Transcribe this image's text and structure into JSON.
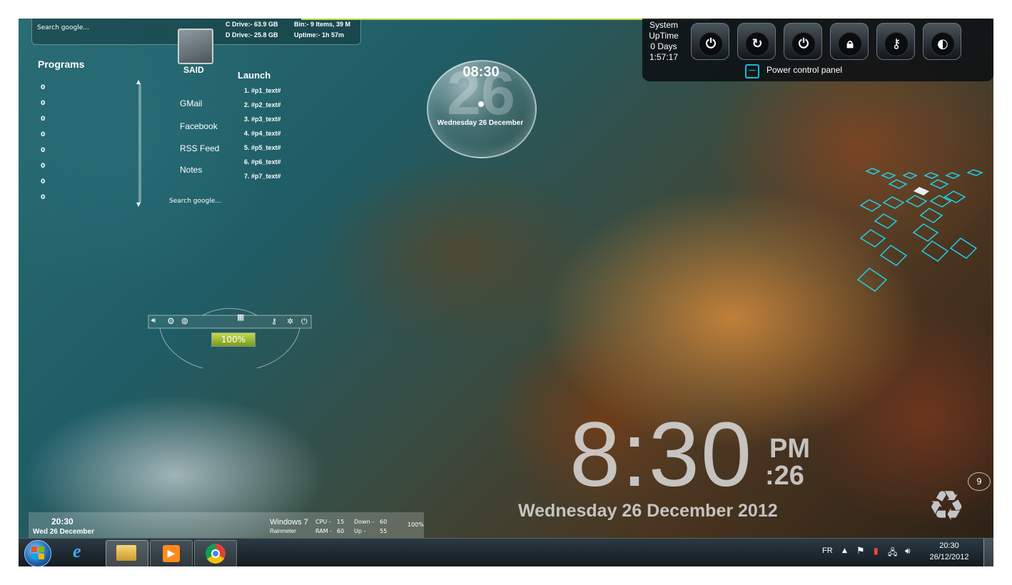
{
  "top_bar": {
    "search_placeholder": "Search google...",
    "c_drive": "C Drive:- 63.9 GB",
    "d_drive": "D Drive:- 25.8 GB",
    "bin": "Bin:- 9  Items, 39 M",
    "uptime": "Uptime:- 1h 57m"
  },
  "programs": {
    "title": "Programs",
    "values": [
      "0",
      "0",
      "0",
      "0",
      "0",
      "0",
      "0",
      "0"
    ]
  },
  "said": {
    "name": "SAID",
    "links": [
      "GMail",
      "Facebook",
      "RSS Feed",
      "Notes"
    ],
    "search_placeholder": "Search google..."
  },
  "launch": {
    "title": "Launch",
    "items": [
      "1. #p1_text#",
      "2. #p2_text#",
      "3. #p3_text#",
      "4. #p4_text#",
      "5. #p5_text#",
      "6. #p6_text#",
      "7. #p7_text#"
    ]
  },
  "bubble_clock": {
    "time": "08:30",
    "day": "26",
    "date": "Wednesday 26 December"
  },
  "power_panel": {
    "uptime_lines": [
      "System",
      "UpTime",
      "0 Days",
      "1:57:17"
    ],
    "label": "Power control panel",
    "button_icons": [
      "power-icon",
      "restart-icon",
      "shutdown-icon",
      "lock-icon",
      "key-icon",
      "hibernate-icon"
    ]
  },
  "volume_widget": {
    "percent": "100%",
    "level": 1.0
  },
  "big_clock": {
    "time": "8:30",
    "ampm": "PM",
    "seconds": ":26",
    "date": "Wednesday 26 December 2012"
  },
  "recycle_bin": {
    "count": "9"
  },
  "bottom_strip": {
    "time": "20:30",
    "date": "Wed 26 December",
    "os": "Windows 7",
    "app": "Rainmeter",
    "cpu_label": "CPU -",
    "cpu_value": "15",
    "ram_label": "RAM -",
    "ram_value": "60",
    "down_label": "Down -",
    "down_value": "60",
    "up_label": "Up -",
    "up_value": "55",
    "percent": "100%"
  },
  "taskbar": {
    "language": "FR",
    "time": "20:30",
    "date": "26/12/2012",
    "apps": [
      "internet-explorer-icon",
      "file-explorer-icon",
      "media-player-icon",
      "chrome-icon"
    ]
  }
}
